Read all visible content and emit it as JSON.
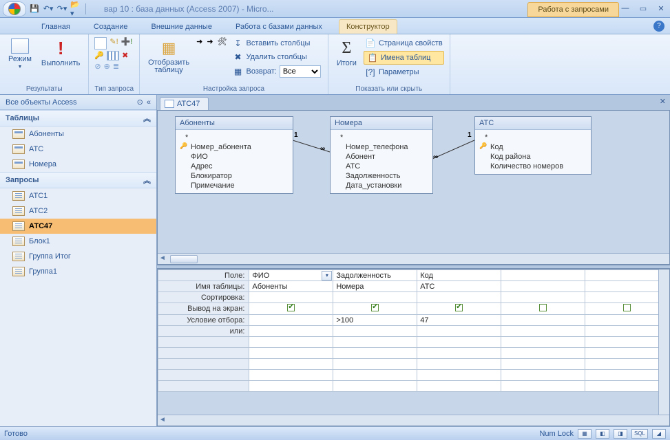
{
  "title": "вар 10 : база данных (Access 2007) - Micro...",
  "context_title": "Работа с запросами",
  "tabs": {
    "home": "Главная",
    "create": "Создание",
    "external": "Внешние данные",
    "dbtools": "Работа с базами данных",
    "design": "Конструктор"
  },
  "ribbon": {
    "results_label": "Результаты",
    "view": "Режим",
    "run": "Выполнить",
    "qtype_label": "Тип запроса",
    "show_table": "Отобразить таблицу",
    "insert_cols": "Вставить столбцы",
    "delete_cols": "Удалить столбцы",
    "return": "Возврат:",
    "return_val": "Все",
    "setup_label": "Настройка запроса",
    "totals": "Итоги",
    "prop_sheet": "Страница свойств",
    "table_names": "Имена таблиц",
    "params": "Параметры",
    "showhide_label": "Показать или скрыть"
  },
  "nav": {
    "header": "Все объекты Access",
    "tables_hdr": "Таблицы",
    "queries_hdr": "Запросы",
    "tables": [
      "Абоненты",
      "АТС",
      "Номера"
    ],
    "queries": [
      "АТС1",
      "АТС2",
      "АТС47",
      "Блок1",
      "Группа Итог",
      "Группа1"
    ]
  },
  "doc_tab": "АТС47",
  "tables": {
    "t1": {
      "title": "Абоненты",
      "fields": [
        "*",
        "Номер_абонента",
        "ФИО",
        "Адрес",
        "Блокиратор",
        "Примечание"
      ],
      "key_index": 1
    },
    "t2": {
      "title": "Номера",
      "fields": [
        "*",
        "Номер_телефона",
        "Абонент",
        "АТС",
        "Задолженность",
        "Дата_установки"
      ],
      "key_index": -1
    },
    "t3": {
      "title": "АТС",
      "fields": [
        "*",
        "Код",
        "Код района",
        "Количество номеров"
      ],
      "key_index": 1
    }
  },
  "grid": {
    "row_field": "Поле:",
    "row_table": "Имя таблицы:",
    "row_sort": "Сортировка:",
    "row_show": "Вывод на экран:",
    "row_crit": "Условие отбора:",
    "row_or": "или:",
    "cols": [
      {
        "field": "ФИО",
        "table": "Абоненты",
        "show": true,
        "crit": ""
      },
      {
        "field": "Задолженность",
        "table": "Номера",
        "show": true,
        "crit": ">100"
      },
      {
        "field": "Код",
        "table": "АТС",
        "show": true,
        "crit": "47"
      },
      {
        "field": "",
        "table": "",
        "show": false,
        "crit": ""
      },
      {
        "field": "",
        "table": "",
        "show": false,
        "crit": ""
      }
    ]
  },
  "status": {
    "ready": "Готово",
    "numlock": "Num Lock",
    "sql": "SQL"
  }
}
